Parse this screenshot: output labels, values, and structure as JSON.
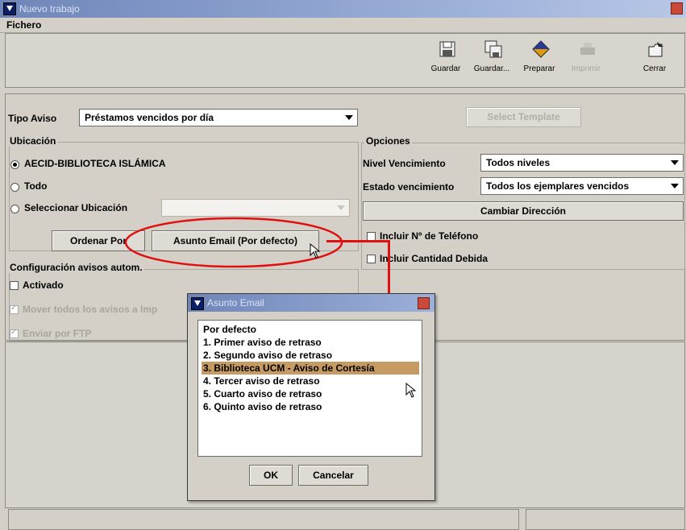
{
  "window": {
    "title": "Nuevo trabajo"
  },
  "menu": {
    "file_label": "Fichero"
  },
  "toolbar": {
    "buttons": [
      {
        "label": "Guardar",
        "icon": "floppy-disk-icon"
      },
      {
        "label": "Guardar...",
        "icon": "save-as-icon"
      },
      {
        "label": "Preparar",
        "icon": "diamond-icon"
      },
      {
        "label": "Imprimir",
        "icon": "printer-icon",
        "disabled": true
      },
      {
        "label": "Cerrar",
        "icon": "close-folder-icon"
      }
    ]
  },
  "form": {
    "tipo_aviso_label": "Tipo Aviso",
    "tipo_aviso_value": "Préstamos vencidos por día",
    "select_template_label": "Select Template",
    "ubicacion_label": "Ubicación",
    "ubicacion_options": [
      {
        "label": "AECID-BIBLIOTECA ISLÁMICA",
        "selected": true
      },
      {
        "label": "Todo",
        "selected": false
      },
      {
        "label": "Seleccionar Ubicación",
        "selected": false
      }
    ],
    "ordenar_por_label": "Ordenar Por",
    "asunto_email_label": "Asunto Email (Por defecto)",
    "config_label": "Configuración avisos autom.",
    "activado_label": "Activado",
    "mover_label": "Mover todos los avisos a Imp",
    "enviar_label": "Enviar por FTP",
    "opciones_label": "Opciones",
    "nivel_label": "Nivel Vencimiento",
    "nivel_value": "Todos niveles",
    "estado_label": "Estado vencimiento",
    "estado_value": "Todos los ejemplares vencidos",
    "cambiar_direccion_label": "Cambiar Dirección",
    "incluir_telefono_label": "Incluir Nº de Teléfono",
    "incluir_cantidad_label": "Incluir Cantidad Debida"
  },
  "dialog": {
    "title": "Asunto Email",
    "items": [
      "Por defecto",
      "1. Primer aviso de retraso",
      "2. Segundo aviso de retraso",
      "3. Biblioteca UCM - Aviso de Cortesía",
      "4. Tercer aviso de retraso",
      "5. Cuarto aviso de retraso",
      "6. Quinto aviso de retraso"
    ],
    "selected_index": 3,
    "ok_label": "OK",
    "cancel_label": "Cancelar"
  },
  "colors": {
    "annotation": "#e01010",
    "selection": "#c59a63",
    "titlebar": "#6f86b8"
  }
}
